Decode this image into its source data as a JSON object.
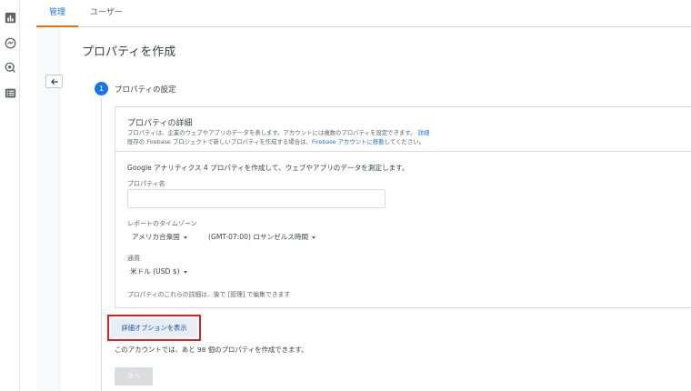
{
  "nav": {
    "rail_icons": [
      "bar-chart-icon",
      "realtime-icon",
      "explore-icon",
      "list-icon"
    ],
    "tabs": [
      {
        "label": "管理",
        "active": true
      },
      {
        "label": "ユーザー",
        "active": false
      }
    ]
  },
  "page": {
    "title": "プロパティを作成"
  },
  "step": {
    "number": "1",
    "label": "プロパティの設定"
  },
  "details": {
    "title": "プロパティの詳細",
    "desc_line1": "プロパティは、企業のウェブやアプリのデータを表します。アカウントには複数のプロパティを設定できます。",
    "desc_link1": "詳細",
    "desc_line2_pre": "既存の Firebase プロジェクトで新しいプロパティを作成する場合は、",
    "desc_link2": "Firebase アカウントに移動",
    "desc_line2_post": "してください。"
  },
  "form": {
    "intro": "Google アナリティクス 4 プロパティを作成して、ウェブやアプリのデータを測定します。",
    "property_name_label": "プロパティ名",
    "property_name_value": "",
    "timezone_label": "レポートのタイムゾーン",
    "timezone_country": "アメリカ合衆国",
    "timezone_zone": "(GMT-07:00) ロサンゼルス時間",
    "currency_label": "通貨",
    "currency_value": "米ドル (USD $)",
    "note": "プロパティのこれらの詳細は、後で [管理] で編集できます"
  },
  "actions": {
    "advanced_options": "詳細オプションを表示",
    "remaining": "このアカウントでは、あと 98 個のプロパティを作成できます。",
    "next": "次へ"
  },
  "colors": {
    "accent": "#1a73e8",
    "highlight_border": "#e0201a",
    "tab_indicator": "#e8710a"
  }
}
